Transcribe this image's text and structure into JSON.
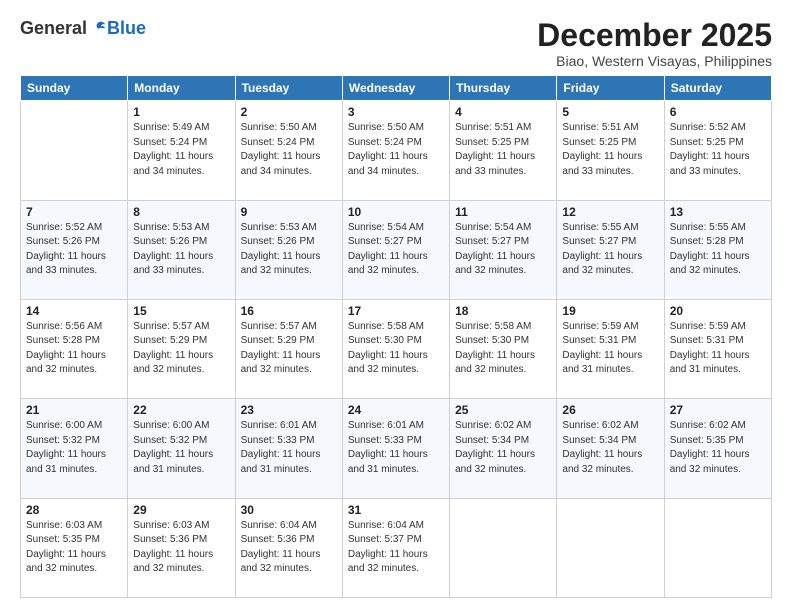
{
  "logo": {
    "general": "General",
    "blue": "Blue"
  },
  "header": {
    "month": "December 2025",
    "location": "Biao, Western Visayas, Philippines"
  },
  "weekdays": [
    "Sunday",
    "Monday",
    "Tuesday",
    "Wednesday",
    "Thursday",
    "Friday",
    "Saturday"
  ],
  "weeks": [
    [
      {
        "day": "",
        "info": ""
      },
      {
        "day": "1",
        "info": "Sunrise: 5:49 AM\nSunset: 5:24 PM\nDaylight: 11 hours\nand 34 minutes."
      },
      {
        "day": "2",
        "info": "Sunrise: 5:50 AM\nSunset: 5:24 PM\nDaylight: 11 hours\nand 34 minutes."
      },
      {
        "day": "3",
        "info": "Sunrise: 5:50 AM\nSunset: 5:24 PM\nDaylight: 11 hours\nand 34 minutes."
      },
      {
        "day": "4",
        "info": "Sunrise: 5:51 AM\nSunset: 5:25 PM\nDaylight: 11 hours\nand 33 minutes."
      },
      {
        "day": "5",
        "info": "Sunrise: 5:51 AM\nSunset: 5:25 PM\nDaylight: 11 hours\nand 33 minutes."
      },
      {
        "day": "6",
        "info": "Sunrise: 5:52 AM\nSunset: 5:25 PM\nDaylight: 11 hours\nand 33 minutes."
      }
    ],
    [
      {
        "day": "7",
        "info": "Sunrise: 5:52 AM\nSunset: 5:26 PM\nDaylight: 11 hours\nand 33 minutes."
      },
      {
        "day": "8",
        "info": "Sunrise: 5:53 AM\nSunset: 5:26 PM\nDaylight: 11 hours\nand 33 minutes."
      },
      {
        "day": "9",
        "info": "Sunrise: 5:53 AM\nSunset: 5:26 PM\nDaylight: 11 hours\nand 32 minutes."
      },
      {
        "day": "10",
        "info": "Sunrise: 5:54 AM\nSunset: 5:27 PM\nDaylight: 11 hours\nand 32 minutes."
      },
      {
        "day": "11",
        "info": "Sunrise: 5:54 AM\nSunset: 5:27 PM\nDaylight: 11 hours\nand 32 minutes."
      },
      {
        "day": "12",
        "info": "Sunrise: 5:55 AM\nSunset: 5:27 PM\nDaylight: 11 hours\nand 32 minutes."
      },
      {
        "day": "13",
        "info": "Sunrise: 5:55 AM\nSunset: 5:28 PM\nDaylight: 11 hours\nand 32 minutes."
      }
    ],
    [
      {
        "day": "14",
        "info": "Sunrise: 5:56 AM\nSunset: 5:28 PM\nDaylight: 11 hours\nand 32 minutes."
      },
      {
        "day": "15",
        "info": "Sunrise: 5:57 AM\nSunset: 5:29 PM\nDaylight: 11 hours\nand 32 minutes."
      },
      {
        "day": "16",
        "info": "Sunrise: 5:57 AM\nSunset: 5:29 PM\nDaylight: 11 hours\nand 32 minutes."
      },
      {
        "day": "17",
        "info": "Sunrise: 5:58 AM\nSunset: 5:30 PM\nDaylight: 11 hours\nand 32 minutes."
      },
      {
        "day": "18",
        "info": "Sunrise: 5:58 AM\nSunset: 5:30 PM\nDaylight: 11 hours\nand 32 minutes."
      },
      {
        "day": "19",
        "info": "Sunrise: 5:59 AM\nSunset: 5:31 PM\nDaylight: 11 hours\nand 31 minutes."
      },
      {
        "day": "20",
        "info": "Sunrise: 5:59 AM\nSunset: 5:31 PM\nDaylight: 11 hours\nand 31 minutes."
      }
    ],
    [
      {
        "day": "21",
        "info": "Sunrise: 6:00 AM\nSunset: 5:32 PM\nDaylight: 11 hours\nand 31 minutes."
      },
      {
        "day": "22",
        "info": "Sunrise: 6:00 AM\nSunset: 5:32 PM\nDaylight: 11 hours\nand 31 minutes."
      },
      {
        "day": "23",
        "info": "Sunrise: 6:01 AM\nSunset: 5:33 PM\nDaylight: 11 hours\nand 31 minutes."
      },
      {
        "day": "24",
        "info": "Sunrise: 6:01 AM\nSunset: 5:33 PM\nDaylight: 11 hours\nand 31 minutes."
      },
      {
        "day": "25",
        "info": "Sunrise: 6:02 AM\nSunset: 5:34 PM\nDaylight: 11 hours\nand 32 minutes."
      },
      {
        "day": "26",
        "info": "Sunrise: 6:02 AM\nSunset: 5:34 PM\nDaylight: 11 hours\nand 32 minutes."
      },
      {
        "day": "27",
        "info": "Sunrise: 6:02 AM\nSunset: 5:35 PM\nDaylight: 11 hours\nand 32 minutes."
      }
    ],
    [
      {
        "day": "28",
        "info": "Sunrise: 6:03 AM\nSunset: 5:35 PM\nDaylight: 11 hours\nand 32 minutes."
      },
      {
        "day": "29",
        "info": "Sunrise: 6:03 AM\nSunset: 5:36 PM\nDaylight: 11 hours\nand 32 minutes."
      },
      {
        "day": "30",
        "info": "Sunrise: 6:04 AM\nSunset: 5:36 PM\nDaylight: 11 hours\nand 32 minutes."
      },
      {
        "day": "31",
        "info": "Sunrise: 6:04 AM\nSunset: 5:37 PM\nDaylight: 11 hours\nand 32 minutes."
      },
      {
        "day": "",
        "info": ""
      },
      {
        "day": "",
        "info": ""
      },
      {
        "day": "",
        "info": ""
      }
    ]
  ]
}
